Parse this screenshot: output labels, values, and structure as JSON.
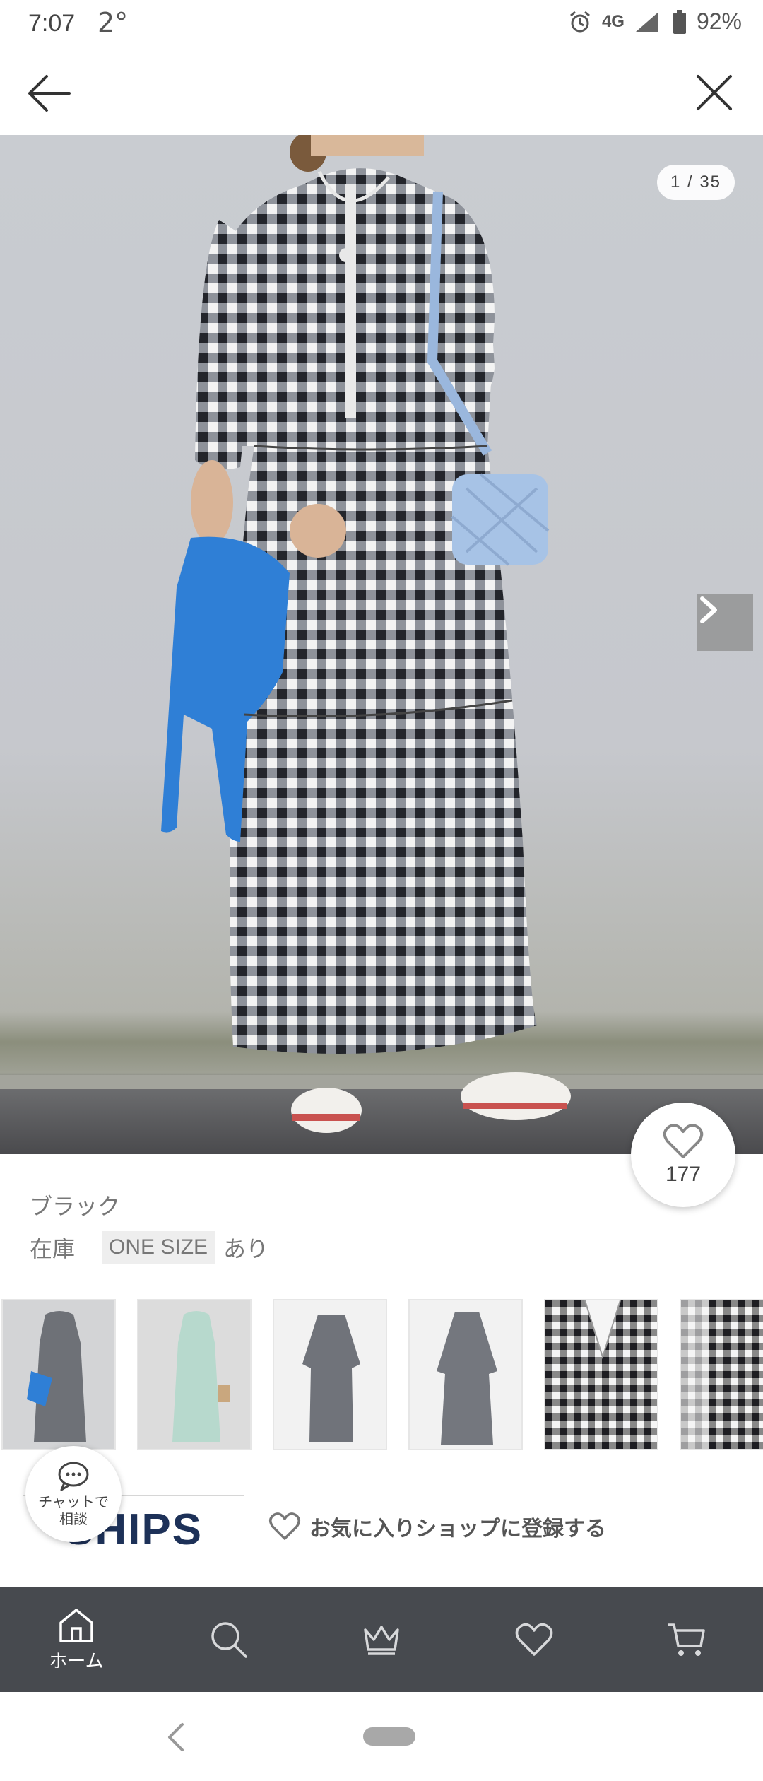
{
  "status_bar": {
    "time": "7:07",
    "temp": "2°",
    "network": "4G",
    "battery": "92%"
  },
  "hero": {
    "counter": "1 / 35"
  },
  "favorite": {
    "count": "177"
  },
  "product": {
    "color": "ブラック",
    "stock_label": "在庫",
    "stock_size": "ONE SIZE",
    "stock_status": "あり"
  },
  "thumbnails": [
    {
      "name": "thumb-1"
    },
    {
      "name": "thumb-2"
    },
    {
      "name": "thumb-3"
    },
    {
      "name": "thumb-4"
    },
    {
      "name": "thumb-5"
    },
    {
      "name": "thumb-6"
    }
  ],
  "shop": {
    "logo_text": "SHIPS",
    "favorite_shop_label": "お気に入りショップに登録する"
  },
  "chat": {
    "label": "チャットで\n相談"
  },
  "tab_bar": {
    "home_label": "ホーム"
  },
  "colors": {
    "tab_bar_bg": "#474a4f",
    "shop_logo": "#1d3158",
    "accent_blue": "#2f7fd6"
  }
}
